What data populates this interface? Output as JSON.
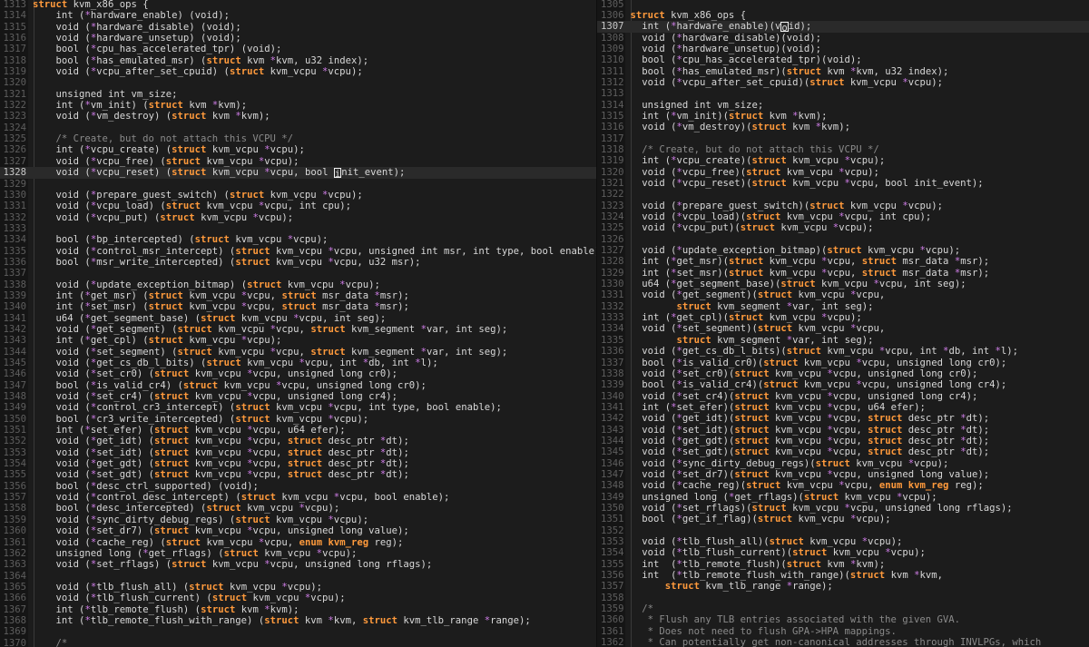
{
  "colors": {
    "keyword": "#ff9a3c",
    "pointer": "#d07ee8",
    "comment": "#8a8a8a",
    "text": "#d8d8d8",
    "line_number": "#5e5e5e",
    "background": "#1c1c1c",
    "current_line": "#2a2a2a"
  },
  "left_pane": {
    "cursor_line": 1328,
    "cursor_col": 52,
    "lines": [
      {
        "n": 1313,
        "text": "struct kvm_x86_ops {"
      },
      {
        "n": 1314,
        "text": "    int (*hardware_enable) (void);"
      },
      {
        "n": 1315,
        "text": "    void (*hardware_disable) (void);"
      },
      {
        "n": 1316,
        "text": "    void (*hardware_unsetup) (void);"
      },
      {
        "n": 1317,
        "text": "    bool (*cpu_has_accelerated_tpr) (void);"
      },
      {
        "n": 1318,
        "text": "    bool (*has_emulated_msr) (struct kvm *kvm, u32 index);"
      },
      {
        "n": 1319,
        "text": "    void (*vcpu_after_set_cpuid) (struct kvm_vcpu *vcpu);"
      },
      {
        "n": 1320,
        "text": ""
      },
      {
        "n": 1321,
        "text": "    unsigned int vm_size;"
      },
      {
        "n": 1322,
        "text": "    int (*vm_init) (struct kvm *kvm);"
      },
      {
        "n": 1323,
        "text": "    void (*vm_destroy) (struct kvm *kvm);"
      },
      {
        "n": 1324,
        "text": ""
      },
      {
        "n": 1325,
        "text": "    /* Create, but do not attach this VCPU */"
      },
      {
        "n": 1326,
        "text": "    int (*vcpu_create) (struct kvm_vcpu *vcpu);"
      },
      {
        "n": 1327,
        "text": "    void (*vcpu_free) (struct kvm_vcpu *vcpu);"
      },
      {
        "n": 1328,
        "text": "    void (*vcpu_reset) (struct kvm_vcpu *vcpu, bool init_event);"
      },
      {
        "n": 1329,
        "text": ""
      },
      {
        "n": 1330,
        "text": "    void (*prepare_guest_switch) (struct kvm_vcpu *vcpu);"
      },
      {
        "n": 1331,
        "text": "    void (*vcpu_load) (struct kvm_vcpu *vcpu, int cpu);"
      },
      {
        "n": 1332,
        "text": "    void (*vcpu_put) (struct kvm_vcpu *vcpu);"
      },
      {
        "n": 1333,
        "text": ""
      },
      {
        "n": 1334,
        "text": "    bool (*bp_intercepted) (struct kvm_vcpu *vcpu);"
      },
      {
        "n": 1335,
        "text": "    void (*control_msr_intercept) (struct kvm_vcpu *vcpu, unsigned int msr, int type, bool enable);"
      },
      {
        "n": 1336,
        "text": "    bool (*msr_write_intercepted) (struct kvm_vcpu *vcpu, u32 msr);"
      },
      {
        "n": 1337,
        "text": ""
      },
      {
        "n": 1338,
        "text": "    void (*update_exception_bitmap) (struct kvm_vcpu *vcpu);"
      },
      {
        "n": 1339,
        "text": "    int (*get_msr) (struct kvm_vcpu *vcpu, struct msr_data *msr);"
      },
      {
        "n": 1340,
        "text": "    int (*set_msr) (struct kvm_vcpu *vcpu, struct msr_data *msr);"
      },
      {
        "n": 1341,
        "text": "    u64 (*get_segment_base) (struct kvm_vcpu *vcpu, int seg);"
      },
      {
        "n": 1342,
        "text": "    void (*get_segment) (struct kvm_vcpu *vcpu, struct kvm_segment *var, int seg);"
      },
      {
        "n": 1343,
        "text": "    int (*get_cpl) (struct kvm_vcpu *vcpu);"
      },
      {
        "n": 1344,
        "text": "    void (*set_segment) (struct kvm_vcpu *vcpu, struct kvm_segment *var, int seg);"
      },
      {
        "n": 1345,
        "text": "    void (*get_cs_db_l_bits) (struct kvm_vcpu *vcpu, int *db, int *l);"
      },
      {
        "n": 1346,
        "text": "    void (*set_cr0) (struct kvm_vcpu *vcpu, unsigned long cr0);"
      },
      {
        "n": 1347,
        "text": "    bool (*is_valid_cr4) (struct kvm_vcpu *vcpu, unsigned long cr0);"
      },
      {
        "n": 1348,
        "text": "    void (*set_cr4) (struct kvm_vcpu *vcpu, unsigned long cr4);"
      },
      {
        "n": 1349,
        "text": "    void (*control_cr3_intercept) (struct kvm_vcpu *vcpu, int type, bool enable);"
      },
      {
        "n": 1350,
        "text": "    bool (*cr3_write_intercepted) (struct kvm_vcpu *vcpu);"
      },
      {
        "n": 1351,
        "text": "    int (*set_efer) (struct kvm_vcpu *vcpu, u64 efer);"
      },
      {
        "n": 1352,
        "text": "    void (*get_idt) (struct kvm_vcpu *vcpu, struct desc_ptr *dt);"
      },
      {
        "n": 1353,
        "text": "    void (*set_idt) (struct kvm_vcpu *vcpu, struct desc_ptr *dt);"
      },
      {
        "n": 1354,
        "text": "    void (*get_gdt) (struct kvm_vcpu *vcpu, struct desc_ptr *dt);"
      },
      {
        "n": 1355,
        "text": "    void (*set_gdt) (struct kvm_vcpu *vcpu, struct desc_ptr *dt);"
      },
      {
        "n": 1356,
        "text": "    bool (*desc_ctrl_supported) (void);"
      },
      {
        "n": 1357,
        "text": "    void (*control_desc_intercept) (struct kvm_vcpu *vcpu, bool enable);"
      },
      {
        "n": 1358,
        "text": "    bool (*desc_intercepted) (struct kvm_vcpu *vcpu);"
      },
      {
        "n": 1359,
        "text": "    void (*sync_dirty_debug_regs) (struct kvm_vcpu *vcpu);"
      },
      {
        "n": 1360,
        "text": "    void (*set_dr7) (struct kvm_vcpu *vcpu, unsigned long value);"
      },
      {
        "n": 1361,
        "text": "    void (*cache_reg) (struct kvm_vcpu *vcpu, enum kvm_reg reg);"
      },
      {
        "n": 1362,
        "text": "    unsigned long (*get_rflags) (struct kvm_vcpu *vcpu);"
      },
      {
        "n": 1363,
        "text": "    void (*set_rflags) (struct kvm_vcpu *vcpu, unsigned long rflags);"
      },
      {
        "n": 1364,
        "text": ""
      },
      {
        "n": 1365,
        "text": "    void (*tlb_flush_all) (struct kvm_vcpu *vcpu);"
      },
      {
        "n": 1366,
        "text": "    void (*tlb_flush_current) (struct kvm_vcpu *vcpu);"
      },
      {
        "n": 1367,
        "text": "    int (*tlb_remote_flush) (struct kvm *kvm);"
      },
      {
        "n": 1368,
        "text": "    int (*tlb_remote_flush_with_range) (struct kvm *kvm, struct kvm_tlb_range *range);"
      },
      {
        "n": 1369,
        "text": ""
      },
      {
        "n": 1370,
        "text": "    /*"
      }
    ]
  },
  "right_pane": {
    "cursor_line": 1307,
    "cursor_col": 26,
    "lines": [
      {
        "n": 1305,
        "text": ""
      },
      {
        "n": 1306,
        "text": "struct kvm_x86_ops {"
      },
      {
        "n": 1307,
        "text": "  int (*hardware_enable)(void);"
      },
      {
        "n": 1308,
        "text": "  void (*hardware_disable)(void);"
      },
      {
        "n": 1309,
        "text": "  void (*hardware_unsetup)(void);"
      },
      {
        "n": 1310,
        "text": "  bool (*cpu_has_accelerated_tpr)(void);"
      },
      {
        "n": 1311,
        "text": "  bool (*has_emulated_msr)(struct kvm *kvm, u32 index);"
      },
      {
        "n": 1312,
        "text": "  void (*vcpu_after_set_cpuid)(struct kvm_vcpu *vcpu);"
      },
      {
        "n": 1313,
        "text": ""
      },
      {
        "n": 1314,
        "text": "  unsigned int vm_size;"
      },
      {
        "n": 1315,
        "text": "  int (*vm_init)(struct kvm *kvm);"
      },
      {
        "n": 1316,
        "text": "  void (*vm_destroy)(struct kvm *kvm);"
      },
      {
        "n": 1317,
        "text": ""
      },
      {
        "n": 1318,
        "text": "  /* Create, but do not attach this VCPU */"
      },
      {
        "n": 1319,
        "text": "  int (*vcpu_create)(struct kvm_vcpu *vcpu);"
      },
      {
        "n": 1320,
        "text": "  void (*vcpu_free)(struct kvm_vcpu *vcpu);"
      },
      {
        "n": 1321,
        "text": "  void (*vcpu_reset)(struct kvm_vcpu *vcpu, bool init_event);"
      },
      {
        "n": 1322,
        "text": ""
      },
      {
        "n": 1323,
        "text": "  void (*prepare_guest_switch)(struct kvm_vcpu *vcpu);"
      },
      {
        "n": 1324,
        "text": "  void (*vcpu_load)(struct kvm_vcpu *vcpu, int cpu);"
      },
      {
        "n": 1325,
        "text": "  void (*vcpu_put)(struct kvm_vcpu *vcpu);"
      },
      {
        "n": 1326,
        "text": ""
      },
      {
        "n": 1327,
        "text": "  void (*update_exception_bitmap)(struct kvm_vcpu *vcpu);"
      },
      {
        "n": 1328,
        "text": "  int (*get_msr)(struct kvm_vcpu *vcpu, struct msr_data *msr);"
      },
      {
        "n": 1329,
        "text": "  int (*set_msr)(struct kvm_vcpu *vcpu, struct msr_data *msr);"
      },
      {
        "n": 1330,
        "text": "  u64 (*get_segment_base)(struct kvm_vcpu *vcpu, int seg);"
      },
      {
        "n": 1331,
        "text": "  void (*get_segment)(struct kvm_vcpu *vcpu,"
      },
      {
        "n": 1332,
        "text": "        struct kvm_segment *var, int seg);"
      },
      {
        "n": 1333,
        "text": "  int (*get_cpl)(struct kvm_vcpu *vcpu);"
      },
      {
        "n": 1334,
        "text": "  void (*set_segment)(struct kvm_vcpu *vcpu,"
      },
      {
        "n": 1335,
        "text": "        struct kvm_segment *var, int seg);"
      },
      {
        "n": 1336,
        "text": "  void (*get_cs_db_l_bits)(struct kvm_vcpu *vcpu, int *db, int *l);"
      },
      {
        "n": 1337,
        "text": "  bool (*is_valid_cr0)(struct kvm_vcpu *vcpu, unsigned long cr0);"
      },
      {
        "n": 1338,
        "text": "  void (*set_cr0)(struct kvm_vcpu *vcpu, unsigned long cr0);"
      },
      {
        "n": 1339,
        "text": "  bool (*is_valid_cr4)(struct kvm_vcpu *vcpu, unsigned long cr4);"
      },
      {
        "n": 1340,
        "text": "  void (*set_cr4)(struct kvm_vcpu *vcpu, unsigned long cr4);"
      },
      {
        "n": 1341,
        "text": "  int (*set_efer)(struct kvm_vcpu *vcpu, u64 efer);"
      },
      {
        "n": 1342,
        "text": "  void (*get_idt)(struct kvm_vcpu *vcpu, struct desc_ptr *dt);"
      },
      {
        "n": 1343,
        "text": "  void (*set_idt)(struct kvm_vcpu *vcpu, struct desc_ptr *dt);"
      },
      {
        "n": 1344,
        "text": "  void (*get_gdt)(struct kvm_vcpu *vcpu, struct desc_ptr *dt);"
      },
      {
        "n": 1345,
        "text": "  void (*set_gdt)(struct kvm_vcpu *vcpu, struct desc_ptr *dt);"
      },
      {
        "n": 1346,
        "text": "  void (*sync_dirty_debug_regs)(struct kvm_vcpu *vcpu);"
      },
      {
        "n": 1347,
        "text": "  void (*set_dr7)(struct kvm_vcpu *vcpu, unsigned long value);"
      },
      {
        "n": 1348,
        "text": "  void (*cache_reg)(struct kvm_vcpu *vcpu, enum kvm_reg reg);"
      },
      {
        "n": 1349,
        "text": "  unsigned long (*get_rflags)(struct kvm_vcpu *vcpu);"
      },
      {
        "n": 1350,
        "text": "  void (*set_rflags)(struct kvm_vcpu *vcpu, unsigned long rflags);"
      },
      {
        "n": 1351,
        "text": "  bool (*get_if_flag)(struct kvm_vcpu *vcpu);"
      },
      {
        "n": 1352,
        "text": ""
      },
      {
        "n": 1353,
        "text": "  void (*tlb_flush_all)(struct kvm_vcpu *vcpu);"
      },
      {
        "n": 1354,
        "text": "  void (*tlb_flush_current)(struct kvm_vcpu *vcpu);"
      },
      {
        "n": 1355,
        "text": "  int  (*tlb_remote_flush)(struct kvm *kvm);"
      },
      {
        "n": 1356,
        "text": "  int  (*tlb_remote_flush_with_range)(struct kvm *kvm,"
      },
      {
        "n": 1357,
        "text": "      struct kvm_tlb_range *range);"
      },
      {
        "n": 1358,
        "text": ""
      },
      {
        "n": 1359,
        "text": "  /*"
      },
      {
        "n": 1360,
        "text": "   * Flush any TLB entries associated with the given GVA."
      },
      {
        "n": 1361,
        "text": "   * Does not need to flush GPA->HPA mappings."
      },
      {
        "n": 1362,
        "text": "   * Can potentially get non-canonical addresses through INVLPGs, which"
      }
    ]
  }
}
